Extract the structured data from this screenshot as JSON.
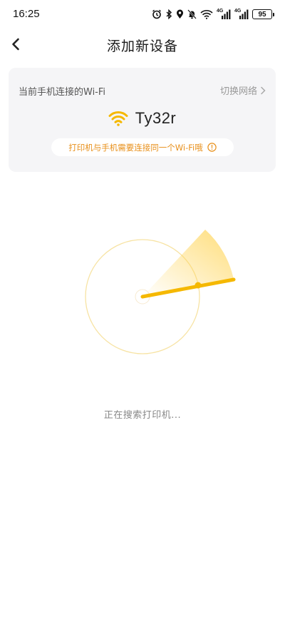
{
  "status_bar": {
    "time": "16:25",
    "network_type_1": "4G",
    "network_type_2": "4G",
    "battery_level": "95",
    "icons": [
      "alarm-icon",
      "bluetooth-icon",
      "location-icon",
      "mute-icon",
      "wifi-icon",
      "signal-icon",
      "signal-icon",
      "battery-icon"
    ]
  },
  "header": {
    "title": "添加新设备",
    "back_icon": "chevron-left-icon"
  },
  "wifi_card": {
    "current_label": "当前手机连接的Wi-Fi",
    "switch_label": "切换网络",
    "ssid": "Ty32r",
    "hint": "打印机与手机需要连接同一个Wi-Fi哦",
    "accent_color": "#f5b800",
    "hint_color": "#e8901b"
  },
  "search": {
    "status_text": "正在搜索打印机..."
  }
}
